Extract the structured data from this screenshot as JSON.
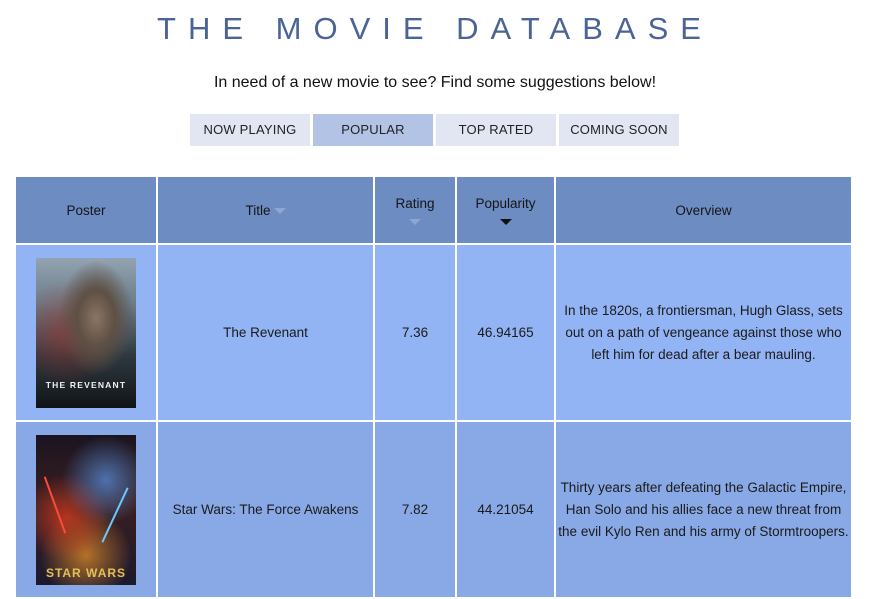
{
  "header": {
    "title": "THE MOVIE DATABASE",
    "subtitle": "In need of a new movie to see? Find some suggestions below!"
  },
  "tabs": [
    {
      "label": "NOW PLAYING",
      "active": false
    },
    {
      "label": "POPULAR",
      "active": true
    },
    {
      "label": "TOP RATED",
      "active": false
    },
    {
      "label": "COMING SOON",
      "active": false
    }
  ],
  "table": {
    "columns": [
      "Poster",
      "Title",
      "Rating",
      "Popularity",
      "Overview"
    ],
    "sort": {
      "column": "Popularity",
      "direction": "desc"
    },
    "rows": [
      {
        "poster_text": "THE REVENANT",
        "title": "The Revenant",
        "rating": "7.36",
        "popularity": "46.94165",
        "overview": "In the 1820s, a frontiersman, Hugh Glass, sets out on a path of vengeance against those who left him for dead after a bear mauling."
      },
      {
        "poster_text": "STAR WARS",
        "title": "Star Wars: The Force Awakens",
        "rating": "7.82",
        "popularity": "44.21054",
        "overview": "Thirty years after defeating the Galactic Empire, Han Solo and his allies face a new threat from the evil Kylo Ren and his army of Stormtroopers."
      }
    ]
  },
  "colors": {
    "title": "#4a6496",
    "tab_bg": "#e1e6f2",
    "tab_active_bg": "#b3c3e6",
    "header_bg": "#6d8cc2",
    "row_odd_bg": "#93b4f4",
    "row_even_bg": "#89a9e6"
  }
}
